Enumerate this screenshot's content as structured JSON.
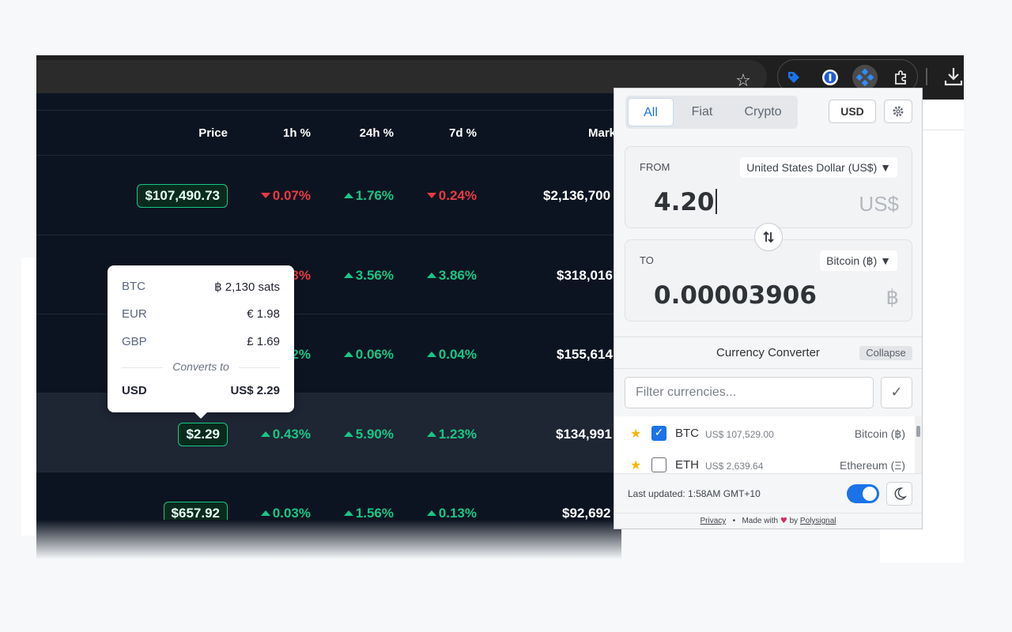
{
  "table": {
    "headers": {
      "price": "Price",
      "h1": "1h %",
      "h24": "24h %",
      "d7": "7d %",
      "mcap": "Mark"
    },
    "rows": [
      {
        "price": "$107,490.73",
        "h1": "0.07%",
        "h24": "1.76%",
        "d7": "0.24%",
        "mcap": "$2,136,700"
      },
      {
        "price": "",
        "h1": "3%",
        "h24": "3.56%",
        "d7": "3.86%",
        "mcap": "$318,016"
      },
      {
        "price": "",
        "h1": "2%",
        "h24": "0.06%",
        "d7": "0.04%",
        "mcap": "$155,614"
      },
      {
        "price": "$2.29",
        "h1": "0.43%",
        "h24": "5.90%",
        "d7": "1.23%",
        "mcap": "$134,991"
      },
      {
        "price": "$657.92",
        "h1": "0.03%",
        "h24": "1.56%",
        "d7": "0.13%",
        "mcap": "$92,692"
      }
    ]
  },
  "tooltip": {
    "rows": [
      {
        "code": "BTC",
        "value": "฿ 2,130 sats"
      },
      {
        "code": "EUR",
        "value": "€ 1.98"
      },
      {
        "code": "GBP",
        "value": "£ 1.69"
      }
    ],
    "divider": "Converts to",
    "target": {
      "code": "USD",
      "value": "US$ 2.29"
    }
  },
  "toolbar": {
    "star_icon": "star-icon",
    "extensions": [
      "tag-extension-icon",
      "password-manager-icon",
      "currency-converter-icon",
      "puzzle-icon"
    ],
    "download_icon": "download-icon"
  },
  "popup": {
    "tabs": [
      "All",
      "Fiat",
      "Crypto"
    ],
    "selected_tab": "All",
    "base_currency": "USD",
    "from": {
      "label": "FROM",
      "currency": "United States Dollar (US$) ▼",
      "value": "4.20",
      "unit": "US$"
    },
    "to": {
      "label": "TO",
      "currency": "Bitcoin (฿) ▼",
      "value": "0.00003906",
      "unit": "฿"
    },
    "converter_title": "Currency Converter",
    "collapse_label": "Collapse",
    "filter_placeholder": "Filter currencies...",
    "currencies": [
      {
        "code": "BTC",
        "price": "US$ 107,529.00",
        "name": "Bitcoin (฿)",
        "checked": true
      },
      {
        "code": "ETH",
        "price": "US$ 2,639.64",
        "name": "Ethereum (Ξ)",
        "checked": false
      }
    ],
    "last_updated": "Last updated: 1:58AM GMT+10",
    "dark_mode_enabled": true,
    "credits": {
      "privacy": "Privacy",
      "dot": "•",
      "made_with": "Made with",
      "by": "by",
      "author": "Polysignal"
    }
  },
  "colors": {
    "up": "#16c784",
    "down": "#ea3943",
    "accent": "#1a73e8"
  }
}
